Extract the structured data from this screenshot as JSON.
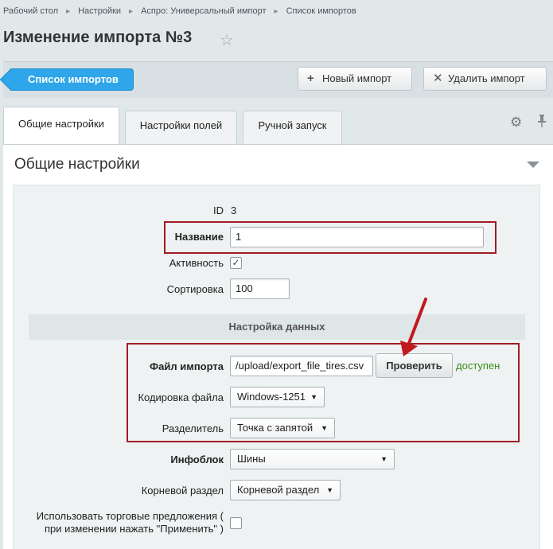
{
  "breadcrumb": [
    "Рабочий стол",
    "Настройки",
    "Аспро: Универсальный импорт",
    "Список импортов"
  ],
  "page_title": "Изменение импорта №3",
  "toolbar": {
    "list_button": "Список импортов",
    "new_button": "Новый импорт",
    "delete_button": "Удалить импорт"
  },
  "tabs": [
    "Общие настройки",
    "Настройки полей",
    "Ручной запуск"
  ],
  "section_title": "Общие настройки",
  "form": {
    "id_label": "ID",
    "id_value": "3",
    "name_label": "Название",
    "name_value": "1",
    "active_label": "Активность",
    "active_checked": "✓",
    "sort_label": "Сортировка",
    "sort_value": "100",
    "data_header": "Настройка данных",
    "file_label": "Файл импорта",
    "file_value": "/upload/export_file_tires.csv",
    "check_button": "Проверить",
    "file_status": "доступен",
    "encoding_label": "Кодировка файла",
    "encoding_value": "Windows-1251",
    "delimiter_label": "Разделитель",
    "delimiter_value": "Точка с запятой",
    "iblock_label": "Инфоблок",
    "iblock_value": "Шины",
    "root_section_label": "Корневой раздел",
    "root_section_value": "Корневой раздел",
    "offers_label_line1": "Использовать торговые предложения (",
    "offers_label_line2": "при изменении нажать \"Применить\" )"
  },
  "colors": {
    "accent": "#2ea6e9",
    "highlight": "#a11c25",
    "status_ok": "#3b8d1a"
  },
  "icons": [
    "star-icon",
    "plus-icon",
    "close-icon",
    "gear-icon",
    "pin-icon",
    "chevron-down-icon",
    "annotation-arrow-icon"
  ]
}
